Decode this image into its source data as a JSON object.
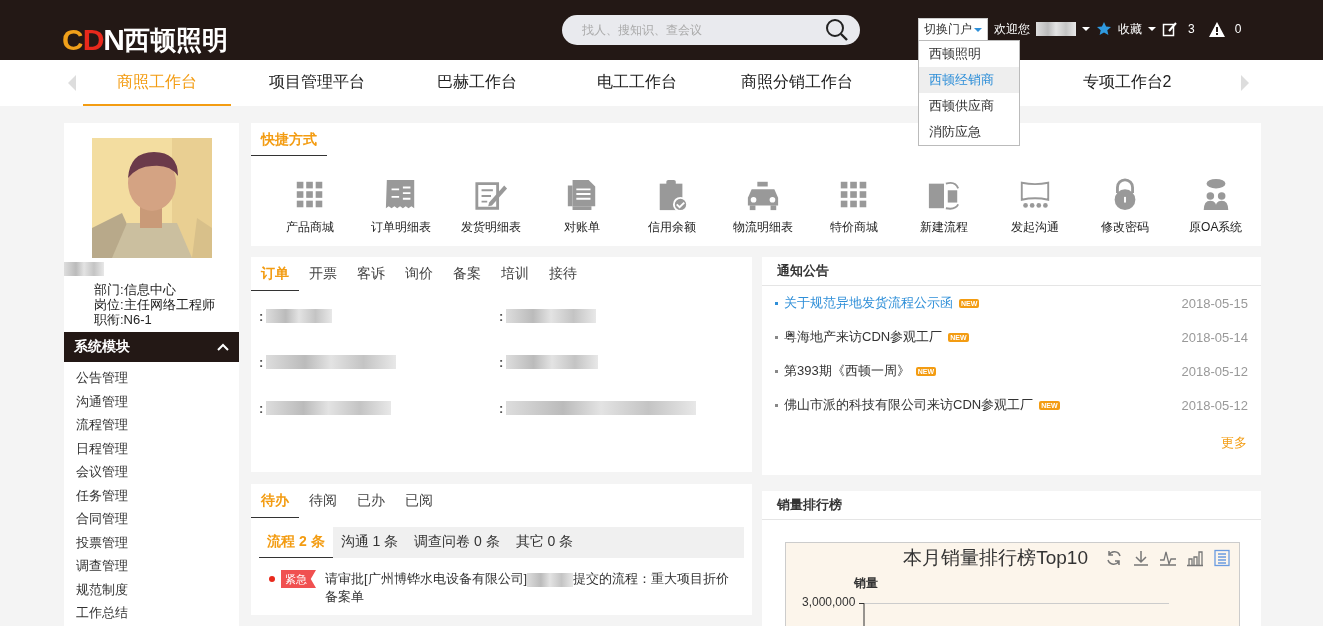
{
  "header": {
    "logo": {
      "mark": "CDN",
      "name": "西顿照明"
    },
    "search": {
      "placeholder": "找人、搜知识、查会议"
    },
    "portal_switch": {
      "label": "切换门户",
      "expanded": true,
      "options": [
        {
          "label": "西顿照明",
          "selected": false
        },
        {
          "label": "西顿经销商",
          "selected": true
        },
        {
          "label": "西顿供应商",
          "selected": false
        },
        {
          "label": "消防应急",
          "selected": false
        }
      ]
    },
    "welcome": "欢迎您",
    "favorites": "收藏",
    "edit_count": "3",
    "alert_count": "0"
  },
  "nav_tabs": [
    {
      "label": "商照工作台",
      "selected": true
    },
    {
      "label": "项目管理平台",
      "selected": false
    },
    {
      "label": "巴赫工作台",
      "selected": false
    },
    {
      "label": "电工工作台",
      "selected": false
    },
    {
      "label": "商照分销工作台",
      "selected": false
    },
    {
      "label": "专项工作台2",
      "selected": false
    }
  ],
  "profile": {
    "department": "部门:信息中心",
    "position": "岗位:主任网络工程师",
    "rank": "职衔:N6-1"
  },
  "sidebar": {
    "title": "系统模块",
    "expanded": true,
    "items": [
      "公告管理",
      "沟通管理",
      "流程管理",
      "日程管理",
      "会议管理",
      "任务管理",
      "合同管理",
      "投票管理",
      "调查管理",
      "规范制度",
      "工作总结"
    ]
  },
  "shortcuts": {
    "title": "快捷方式",
    "items": [
      "产品商城",
      "订单明细表",
      "发货明细表",
      "对账单",
      "信用余额",
      "物流明细表",
      "特价商城",
      "新建流程",
      "发起沟通",
      "修改密码",
      "原OA系统"
    ]
  },
  "orders": {
    "tabs": [
      {
        "label": "订单",
        "selected": true
      },
      {
        "label": "开票",
        "selected": false
      },
      {
        "label": "客诉",
        "selected": false
      },
      {
        "label": "询价",
        "selected": false
      },
      {
        "label": "备案",
        "selected": false
      },
      {
        "label": "培训",
        "selected": false
      },
      {
        "label": "接待",
        "selected": false
      }
    ],
    "fields": [
      ":",
      ":",
      ":",
      ":",
      ":",
      ":"
    ]
  },
  "notices": {
    "title": "通知公告",
    "items": [
      {
        "title": "关于规范异地发货流程公示函",
        "badge": "NEW",
        "date": "2018-05-15",
        "highlighted": true
      },
      {
        "title": "粤海地产来访CDN参观工厂",
        "badge": "NEW",
        "date": "2018-05-14",
        "highlighted": false
      },
      {
        "title": "第393期《西顿一周》",
        "badge": "NEW",
        "date": "2018-05-12",
        "highlighted": false
      },
      {
        "title": "佛山市派的科技有限公司来访CDN参观工厂",
        "badge": "NEW",
        "date": "2018-05-12",
        "highlighted": false
      }
    ],
    "more": "更多"
  },
  "todo": {
    "tabs": [
      {
        "label": "待办",
        "selected": true
      },
      {
        "label": "待阅",
        "selected": false
      },
      {
        "label": "已办",
        "selected": false
      },
      {
        "label": "已阅",
        "selected": false
      }
    ],
    "subtabs": [
      {
        "label": "流程 2 条",
        "selected": true
      },
      {
        "label": "沟通 1 条",
        "selected": false
      },
      {
        "label": "调查问卷 0 条",
        "selected": false
      },
      {
        "label": "其它 0 条",
        "selected": false
      }
    ],
    "items": [
      {
        "urgent": true,
        "tag": "紧急",
        "text_before": "请审批[广州博铧水电设备有限公司]",
        "text_after": "提交的流程：重大项目折价备案单"
      }
    ]
  },
  "sales": {
    "title": "销量排行榜",
    "chart": {
      "title": "本月销量排行榜Top10",
      "ylabel": "销量",
      "ytick": "3,000,000"
    }
  }
}
